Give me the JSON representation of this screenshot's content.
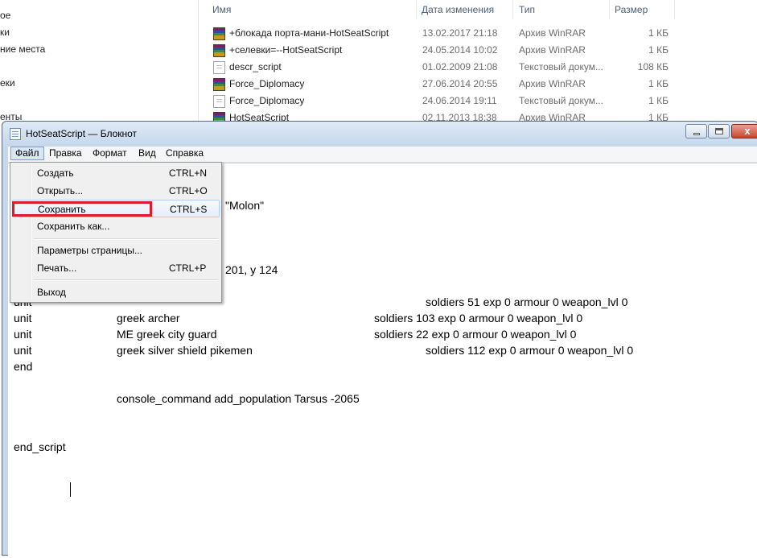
{
  "explorer": {
    "nav_items": [
      "ое",
      "ки",
      "ние места",
      "еки",
      "енты"
    ],
    "columns": {
      "name": "Имя",
      "date": "Дата изменения",
      "type": "Тип",
      "size": "Размер"
    },
    "files": [
      {
        "icon": "winrar-icon",
        "name": "+блокада порта-мани-HotSeatScript",
        "date": "13.02.2017 21:18",
        "type": "Архив WinRAR",
        "size": "1 КБ"
      },
      {
        "icon": "winrar-icon",
        "name": "+селевки=--HotSeatScript",
        "date": "24.05.2014 10:02",
        "type": "Архив WinRAR",
        "size": "1 КБ"
      },
      {
        "icon": "text-file-icon",
        "name": "descr_script",
        "date": "01.02.2009 21:08",
        "type": "Текстовый докум...",
        "size": "108 КБ"
      },
      {
        "icon": "winrar-icon",
        "name": "Force_Diplomacy",
        "date": "27.06.2014 20:55",
        "type": "Архив WinRAR",
        "size": "1 КБ"
      },
      {
        "icon": "text-file-icon",
        "name": "Force_Diplomacy",
        "date": "24.06.2014 19:11",
        "type": "Текстовый докум...",
        "size": "1 КБ"
      },
      {
        "icon": "winrar-icon",
        "name": "HotSeatScript",
        "date": "02.11.2013 18:38",
        "type": "Архив WinRAR",
        "size": "1 КБ"
      }
    ]
  },
  "notepad": {
    "title": "HotSeatScript — Блокнот",
    "close_glyph": "x",
    "menu": [
      "Файл",
      "Правка",
      "Формат",
      "Вид",
      "Справка"
    ],
    "file_menu": [
      {
        "label": "Создать",
        "accel": "CTRL+N"
      },
      {
        "label": "Открыть...",
        "accel": "CTRL+O"
      },
      {
        "label": "Сохранить",
        "accel": "CTRL+S"
      },
      {
        "label": "Сохранить как...",
        "accel": ""
      },
      {
        "label": "Параметры страницы...",
        "accel": ""
      },
      {
        "label": "Печать...",
        "accel": "CTRL+P"
      },
      {
        "label": "Выход",
        "accel": ""
      }
    ],
    "editor_lines": [
      "\"Molon\"",
      "201, y 124",
      "unit",
      "soldiers 51 exp 0 armour 0 weapon_lvl 0",
      "unit",
      "greek archer",
      "soldiers 103 exp 0 armour 0 weapon_lvl 0",
      "unit",
      "ME greek city guard",
      "soldiers 22 exp 0 armour 0 weapon_lvl 0",
      "unit",
      "greek silver shield pikemen",
      "soldiers 112 exp 0 armour 0 weapon_lvl 0",
      "end",
      "console_command add_population Tarsus -2065",
      "end_script"
    ]
  }
}
